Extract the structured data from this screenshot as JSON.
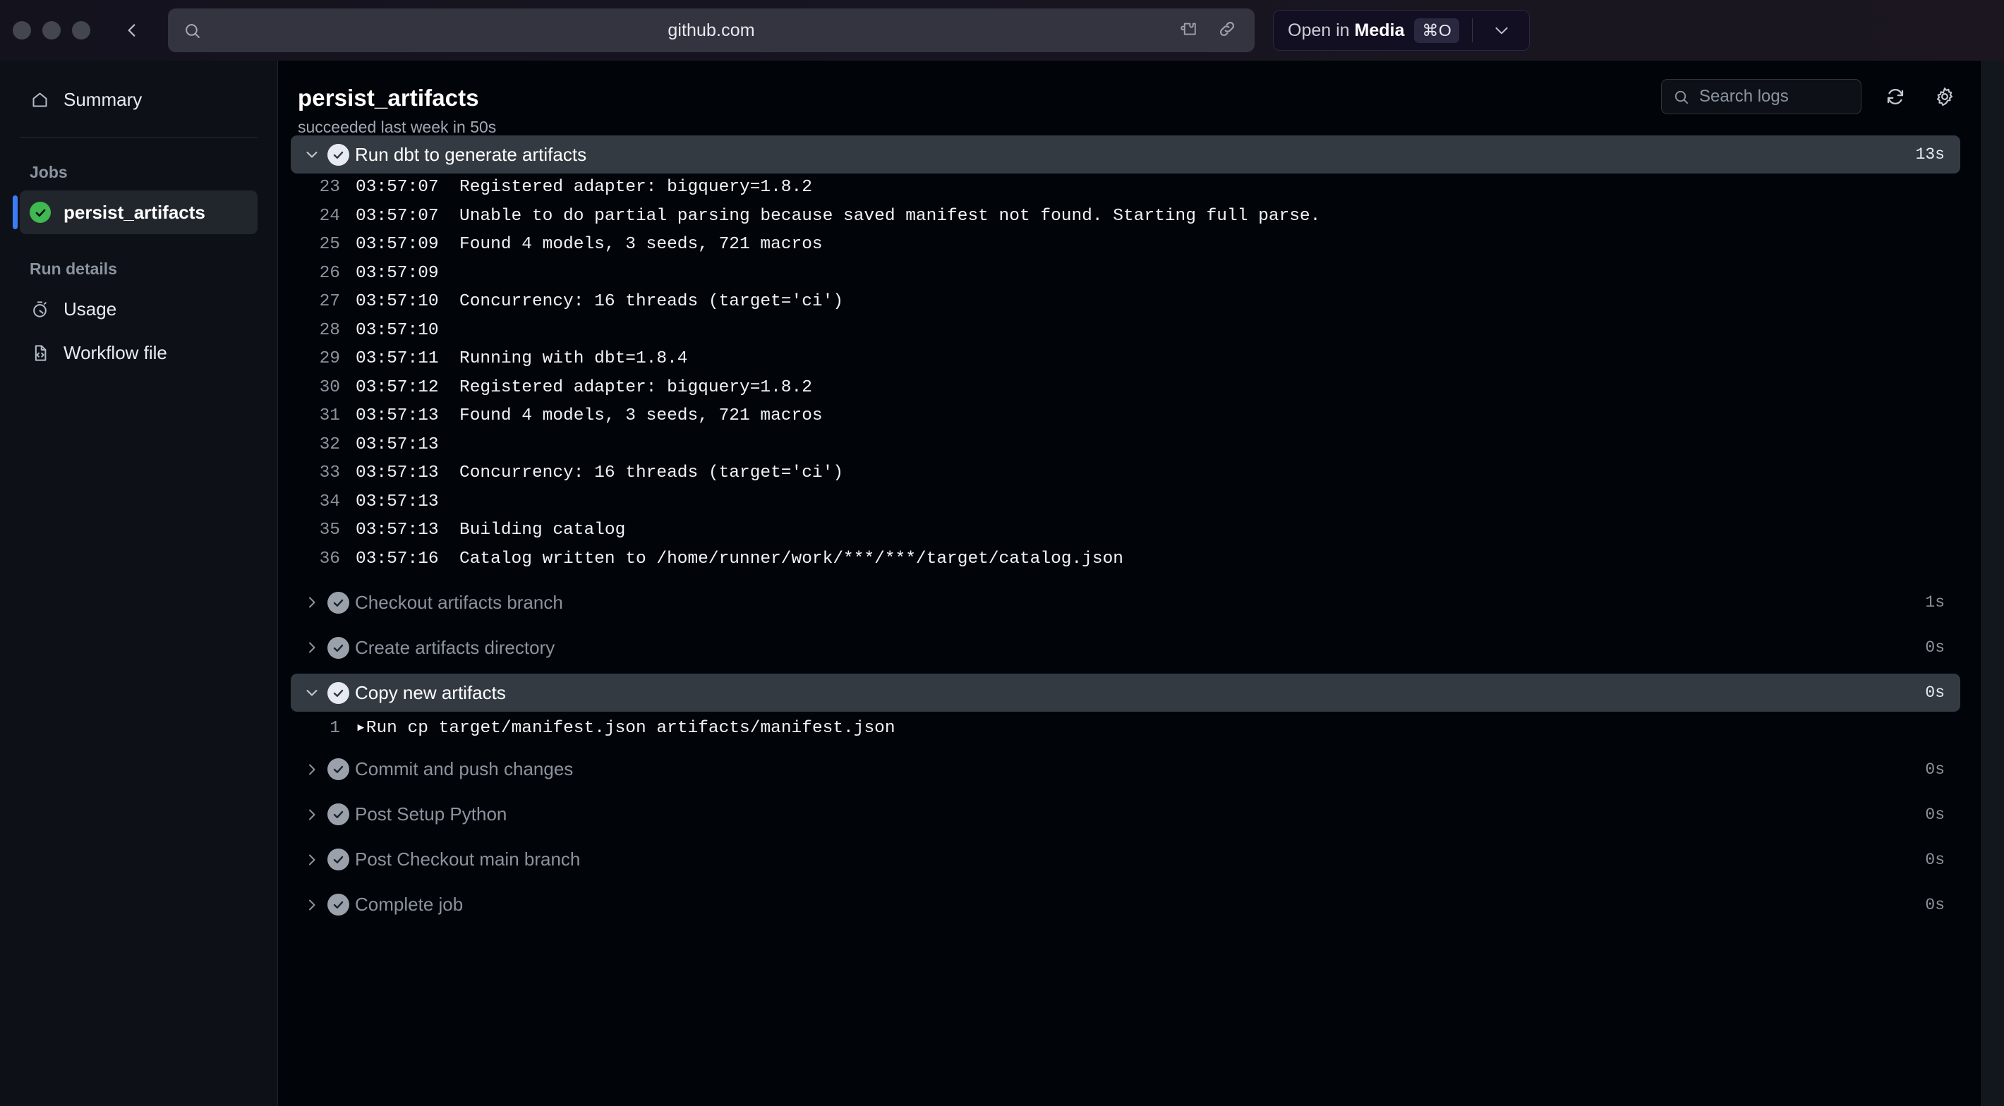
{
  "titlebar": {
    "url": "github.com",
    "open_in_label_prefix": "Open in ",
    "open_in_app": "Media",
    "shortcut": "⌘O",
    "icons": [
      "extension-puzzle-icon",
      "link-icon",
      "chevron-down-icon",
      "back-chevron-icon",
      "search-icon"
    ]
  },
  "sidebar": {
    "summary": {
      "label": "Summary",
      "icon": "home-icon"
    },
    "jobs_label": "Jobs",
    "jobs": [
      {
        "label": "persist_artifacts",
        "status": "succeeded",
        "selected": true
      }
    ],
    "run_details_label": "Run details",
    "run_details": [
      {
        "label": "Usage",
        "icon": "stopwatch-icon"
      },
      {
        "label": "Workflow file",
        "icon": "file-code-icon"
      }
    ]
  },
  "header": {
    "title": "persist_artifacts",
    "subtitle": "succeeded last week in 50s",
    "search_placeholder": "Search logs",
    "search_value": "",
    "refresh_icon": "refresh-icon",
    "settings_icon": "gear-icon"
  },
  "steps": [
    {
      "name": "Run dbt to generate artifacts",
      "duration": "13s",
      "expanded": true,
      "status": "success",
      "log": [
        {
          "n": "23",
          "ts": "03:57:07",
          "text": "Registered adapter: bigquery=1.8.2"
        },
        {
          "n": "24",
          "ts": "03:57:07",
          "text": "Unable to do partial parsing because saved manifest not found. Starting full parse."
        },
        {
          "n": "25",
          "ts": "03:57:09",
          "text": "Found 4 models, 3 seeds, 721 macros"
        },
        {
          "n": "26",
          "ts": "03:57:09",
          "text": ""
        },
        {
          "n": "27",
          "ts": "03:57:10",
          "text": "Concurrency: 16 threads (target='ci')"
        },
        {
          "n": "28",
          "ts": "03:57:10",
          "text": ""
        },
        {
          "n": "29",
          "ts": "03:57:11",
          "text": "Running with dbt=1.8.4"
        },
        {
          "n": "30",
          "ts": "03:57:12",
          "text": "Registered adapter: bigquery=1.8.2"
        },
        {
          "n": "31",
          "ts": "03:57:13",
          "text": "Found 4 models, 3 seeds, 721 macros"
        },
        {
          "n": "32",
          "ts": "03:57:13",
          "text": ""
        },
        {
          "n": "33",
          "ts": "03:57:13",
          "text": "Concurrency: 16 threads (target='ci')"
        },
        {
          "n": "34",
          "ts": "03:57:13",
          "text": ""
        },
        {
          "n": "35",
          "ts": "03:57:13",
          "text": "Building catalog"
        },
        {
          "n": "36",
          "ts": "03:57:16",
          "text": "Catalog written to /home/runner/work/***/***/target/catalog.json"
        }
      ]
    },
    {
      "name": "Checkout artifacts branch",
      "duration": "1s",
      "expanded": false,
      "status": "success",
      "log": []
    },
    {
      "name": "Create artifacts directory",
      "duration": "0s",
      "expanded": false,
      "status": "success",
      "log": []
    },
    {
      "name": "Copy new artifacts",
      "duration": "0s",
      "expanded": true,
      "status": "success",
      "log": [
        {
          "n": "1",
          "ts": "",
          "text": "▸Run cp target/manifest.json artifacts/manifest.json"
        }
      ]
    },
    {
      "name": "Commit and push changes",
      "duration": "0s",
      "expanded": false,
      "status": "success",
      "log": []
    },
    {
      "name": "Post Setup Python",
      "duration": "0s",
      "expanded": false,
      "status": "success",
      "log": []
    },
    {
      "name": "Post Checkout main branch",
      "duration": "0s",
      "expanded": false,
      "status": "success",
      "log": []
    },
    {
      "name": "Complete job",
      "duration": "0s",
      "expanded": false,
      "status": "success",
      "log": []
    }
  ],
  "colors": {
    "accent_blue": "#3b7df8",
    "success_green": "#3fb950",
    "page_bg": "#010409",
    "sidebar_bg": "#0d1117",
    "step_open_bg": "#343a42"
  }
}
